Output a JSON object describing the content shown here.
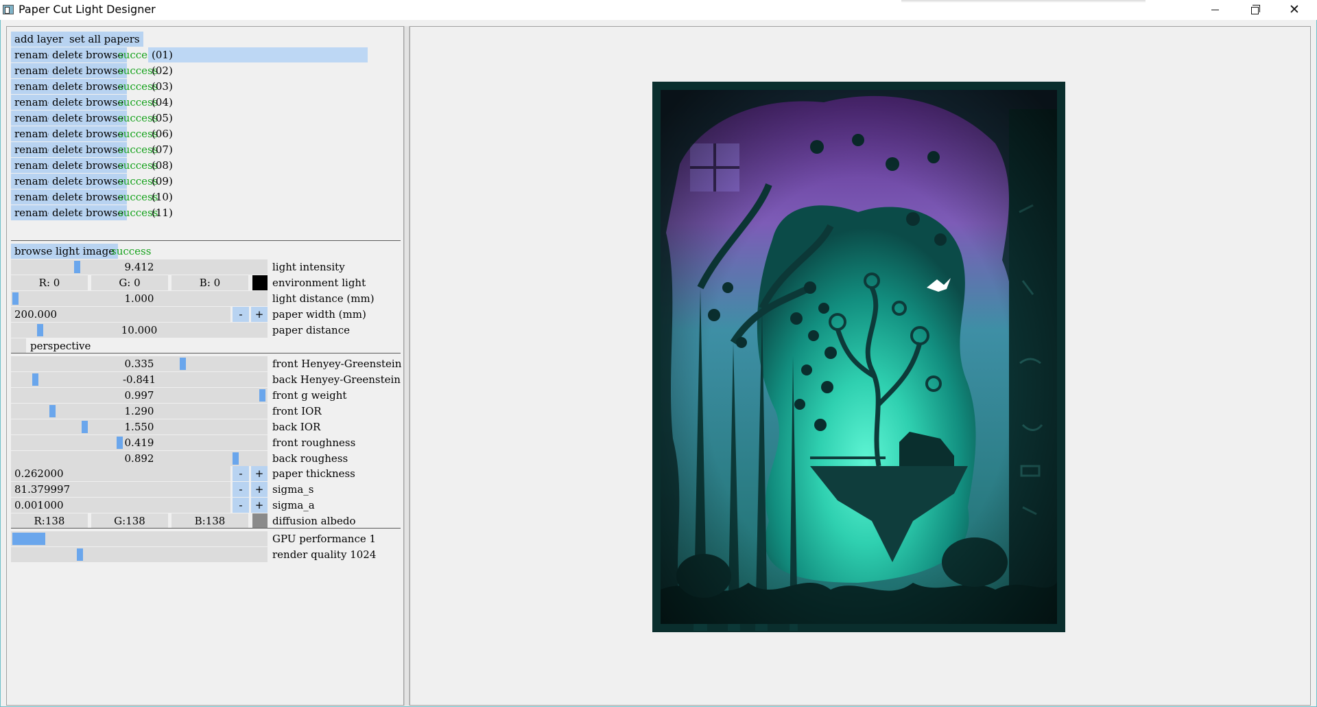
{
  "window": {
    "title": "Paper Cut Light Designer"
  },
  "toolbar": {
    "add_layer": "add layer",
    "set_all_papers": "set all papers"
  },
  "layers": {
    "rename_label": "rename",
    "delete_label": "delete",
    "browse_label": "browse",
    "items": [
      {
        "status": "success",
        "name": "(01)",
        "selected": true
      },
      {
        "status": "success",
        "name": "(02)"
      },
      {
        "status": "success",
        "name": "(03)"
      },
      {
        "status": "success",
        "name": "(04)"
      },
      {
        "status": "success",
        "name": "(05)"
      },
      {
        "status": "success",
        "name": "(06)"
      },
      {
        "status": "success",
        "name": "(07)"
      },
      {
        "status": "success",
        "name": "(08)"
      },
      {
        "status": "success",
        "name": "(09)"
      },
      {
        "status": "success",
        "name": "(10)"
      },
      {
        "status": "success",
        "name": "(11)"
      }
    ]
  },
  "light": {
    "browse_label": "browse light image",
    "status": "success",
    "intensity": {
      "value": "9.412",
      "label": "light intensity",
      "fraction": 0.25
    },
    "environment": {
      "r": "R:  0",
      "g": "G:  0",
      "b": "B:  0",
      "label": "environment light",
      "color": "#000000"
    },
    "distance": {
      "value": "1.000",
      "label": "light distance (mm)",
      "fraction": 0.0
    },
    "paper_width": {
      "value": "200.000",
      "label": "paper width (mm)"
    },
    "paper_distance": {
      "value": "10.000",
      "label": "paper distance",
      "fraction": 0.1
    },
    "perspective_label": "perspective"
  },
  "material": {
    "front_hg": {
      "value": "0.335",
      "label": "front Henyey-Greenstein g",
      "fraction": 0.675
    },
    "back_hg": {
      "value": "-0.841",
      "label": "back  Henyey-Greenstein g",
      "fraction": 0.08
    },
    "front_weight": {
      "value": "0.997",
      "label": "front g weight",
      "fraction": 0.997
    },
    "front_ior": {
      "value": "1.290",
      "label": "front IOR",
      "fraction": 0.15
    },
    "back_ior": {
      "value": "1.550",
      "label": "back IOR",
      "fraction": 0.28
    },
    "front_roughness": {
      "value": "0.419",
      "label": "front roughness",
      "fraction": 0.42
    },
    "back_roughness": {
      "value": "0.892",
      "label": "back  roughess",
      "fraction": 0.89
    },
    "paper_thickness": {
      "value": "0.262000",
      "label": "paper thickness"
    },
    "sigma_s": {
      "value": "81.379997",
      "label": "sigma_s"
    },
    "sigma_a": {
      "value": "0.001000",
      "label": "sigma_a"
    },
    "albedo": {
      "r": "R:138",
      "g": "G:138",
      "b": "B:138",
      "label": "diffusion albedo",
      "color": "#8a8a8a"
    }
  },
  "render": {
    "gpu": {
      "label": "GPU performance  1",
      "fraction": 0.13
    },
    "quality": {
      "label": "render quality  1024",
      "fraction": 0.26
    }
  },
  "spinner": {
    "minus": "-",
    "plus": "+"
  },
  "colors": {
    "button": "#b8d3f1",
    "success": "#16a21c",
    "slider_handle": "#6aa6ec",
    "field": "#dcdcdc"
  }
}
